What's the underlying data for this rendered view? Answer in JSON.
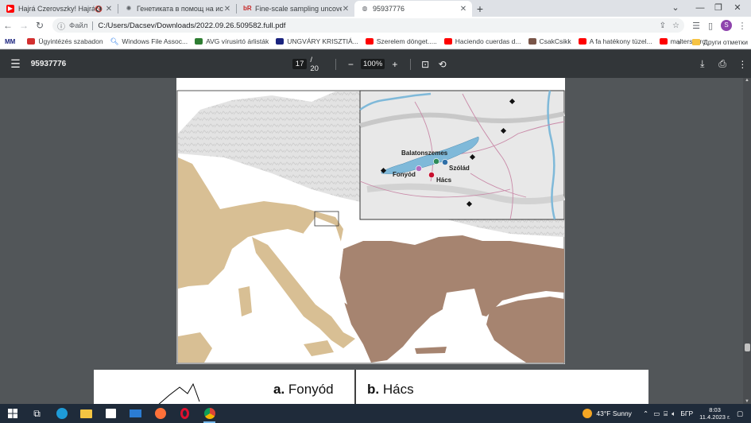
{
  "browser": {
    "tabs": [
      {
        "title": "Hajrá Czerovszky! Hajrá! – Ka",
        "favicon": "youtube-icon",
        "color": "#ff0000",
        "muted": true
      },
      {
        "title": "Генетиката в помощ на историята",
        "favicon": "gear-icon",
        "color": "#5f6368"
      },
      {
        "title": "Fine-scale sampling uncovers the",
        "favicon": "br-icon",
        "color": "#c62828",
        "favicon_text": "bR"
      },
      {
        "title": "95937776",
        "favicon": "globe-icon",
        "color": "#5f6368",
        "active": true
      }
    ],
    "address": {
      "scheme_label": "Файл",
      "url": "C:/Users/Dacsev/Downloads/2022.09.26.509582.full.pdf"
    },
    "profile_initial": "S",
    "profile_color": "#8e44ad",
    "bookmarks": [
      {
        "label": "Ügyintézés szabadon",
        "icon": "bookmark-icon",
        "color": "#d32f2f"
      },
      {
        "label": "Windows File Assoc...",
        "icon": "search-icon",
        "color": "#1a73e8"
      },
      {
        "label": "AVG vírusirtó árlisták",
        "icon": "avg-icon",
        "color": "#2e7d32"
      },
      {
        "label": "UNGVÁRY KRISZTIÁ...",
        "icon": "flag-icon",
        "color": "#1a237e"
      },
      {
        "label": "Szerelem dönget.....",
        "icon": "youtube-icon",
        "color": "#ff0000"
      },
      {
        "label": "Haciendo cuerdas d...",
        "icon": "youtube-icon",
        "color": "#ff0000"
      },
      {
        "label": "CsakCsikk",
        "icon": "pencil-icon",
        "color": "#795548"
      },
      {
        "label": "A fa hatékony tüzel...",
        "icon": "youtube-icon",
        "color": "#ff0000"
      },
      {
        "label": "malterszoro",
        "icon": "youtube-icon",
        "color": "#ff0000"
      }
    ],
    "other_bookmarks": "Други отметки"
  },
  "pdf": {
    "doc_title": "95937776",
    "page_current": "17",
    "page_total": "/ 20",
    "zoom": "100%"
  },
  "figure": {
    "inset_labels": {
      "balatonszemes": "Balatonszemes",
      "szolad": "Szólád",
      "fonyod": "Fonyód",
      "hacs": "Hács"
    },
    "site_colors": {
      "balatonszemes": "#2e8b57",
      "szolad": "#2f6fa7",
      "fonyod": "#b36bbf",
      "hacs": "#c8102e"
    },
    "lake_color": "#7fb9d9",
    "panel_a": {
      "letter": "a.",
      "name": "Fonyód"
    },
    "panel_b": {
      "letter": "b.",
      "name": "Hács"
    }
  },
  "taskbar": {
    "weather": "43°F  Sunny",
    "language": "БГР",
    "time": "8:03",
    "date": "11.4.2023 г."
  }
}
